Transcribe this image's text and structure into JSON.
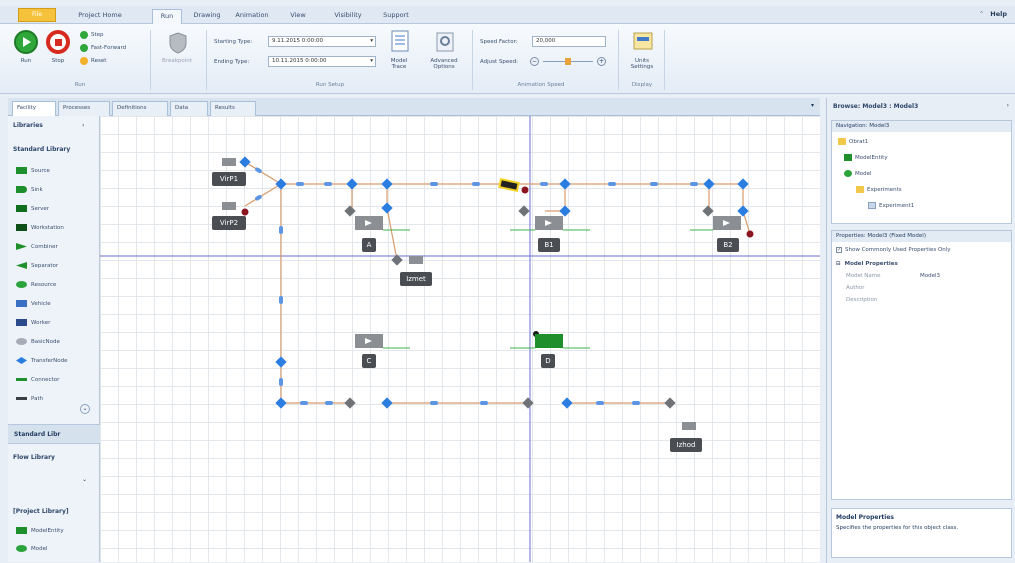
{
  "tabs": {
    "file": "File",
    "items": [
      "Project Home",
      "Run",
      "Drawing",
      "Animation",
      "View",
      "Visibility",
      "Support"
    ],
    "help": "Help"
  },
  "ribbon": {
    "run": {
      "run_label": "Run",
      "stop_label": "Stop",
      "step": "Step",
      "fast_forward": "Fast-Forward",
      "reset": "Reset",
      "group": "Run"
    },
    "breakpoint": "Breakpoint",
    "setup": {
      "starting_label": "Starting Type:",
      "starting_value": "9.11.2015 0:00:00",
      "ending_label": "Ending Type:",
      "ending_value": "10.11.2015 0:00:00",
      "model_trace": "Model Trace",
      "advanced_options": "Advanced Options",
      "group": "Run Setup"
    },
    "animation": {
      "speed_label": "Speed Factor:",
      "speed_value": "20,000",
      "adjust_label": "Adjust Speed:",
      "group": "Animation Speed"
    },
    "display": {
      "units": "Units Settings",
      "group": "Display"
    }
  },
  "doc_tabs": [
    "Facility",
    "Processes",
    "Definitions",
    "Data",
    "Results"
  ],
  "library": {
    "header": "Libraries",
    "standard": "Standard Library",
    "items": [
      "Source",
      "Sink",
      "Server",
      "Workstation",
      "Combiner",
      "Separator",
      "Resource",
      "Vehicle",
      "Worker",
      "BasicNode",
      "TransferNode",
      "Connector",
      "Path"
    ],
    "standard_tab": "Standard Libr",
    "flow": "Flow Library",
    "project": "[Project Library]",
    "project_items": [
      "ModelEntity",
      "Model"
    ]
  },
  "canvas_labels": {
    "source1": "VirP1",
    "source2": "VirP2",
    "server_a": "A",
    "server_b1": "B1",
    "server_b2": "B2",
    "server_c": "C",
    "server_d": "D",
    "combiner": "Izmet",
    "sink": "Izhod"
  },
  "right": {
    "browse": "Browse: Model3 : Model3",
    "nav_title": "Navigation: Model3",
    "nav_items": [
      "Obrat1",
      "ModelEntity",
      "Model",
      "Experiments",
      "Experiment1"
    ],
    "props_title": "Properties: Model3 (Fixed Model)",
    "show_common": "Show Commonly Used Properties Only",
    "props_category": "Model Properties",
    "props_rows": [
      {
        "name": "Model Name",
        "value": "Model3"
      },
      {
        "name": "Author",
        "value": ""
      },
      {
        "name": "Description",
        "value": ""
      }
    ],
    "help_title": "Model Properties",
    "help_text": "Specifies the properties for this object class."
  },
  "colors": {
    "node_blue": "#2b7de0",
    "node_gray": "#6f7378",
    "path_orange": "#d99b6c",
    "server_gray": "#8b8f94",
    "server_green": "#1e8f2a",
    "label_bg": "#4a4d52"
  }
}
